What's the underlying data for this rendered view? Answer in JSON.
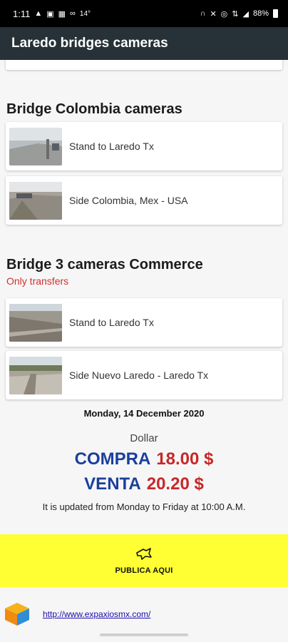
{
  "status_bar": {
    "time": "1:11",
    "left_icons": [
      "warning-icon",
      "image-icon",
      "photo-icon",
      "voicemail-icon"
    ],
    "temperature": "14°",
    "right_icons": [
      "headphones-icon",
      "mute-icon",
      "alarm-icon",
      "data-icon",
      "signal-icon"
    ],
    "battery": "88%"
  },
  "app_bar": {
    "title": "Laredo bridges cameras"
  },
  "sections": {
    "colombia": {
      "title": "Bridge Colombia cameras",
      "cameras": [
        {
          "label": "Stand to Laredo Tx"
        },
        {
          "label": "Side Colombia, Mex - USA"
        }
      ]
    },
    "bridge3": {
      "title": "Bridge 3 cameras Commerce",
      "note": "Only transfers",
      "cameras": [
        {
          "label": "Stand to Laredo Tx"
        },
        {
          "label": "Side Nuevo Laredo - Laredo Tx"
        }
      ]
    }
  },
  "exchange": {
    "date": "Monday, 14 December 2020",
    "currency_label": "Dollar",
    "buy_label": "COMPRA",
    "buy_value": "18.00 $",
    "sell_label": "VENTA",
    "sell_value": "20.20 $",
    "update_note": "It is updated from Monday to Friday at 10:00 A.M."
  },
  "ad": {
    "text": "PUBLICA AQUI"
  },
  "footer": {
    "link": "http://www.expaxiosmx.com/"
  },
  "colors": {
    "app_bar": "#263238",
    "note": "#d32f2f",
    "rate_label": "#1a3f9c",
    "rate_value": "#c62828",
    "ad_background": "#ffff33"
  }
}
